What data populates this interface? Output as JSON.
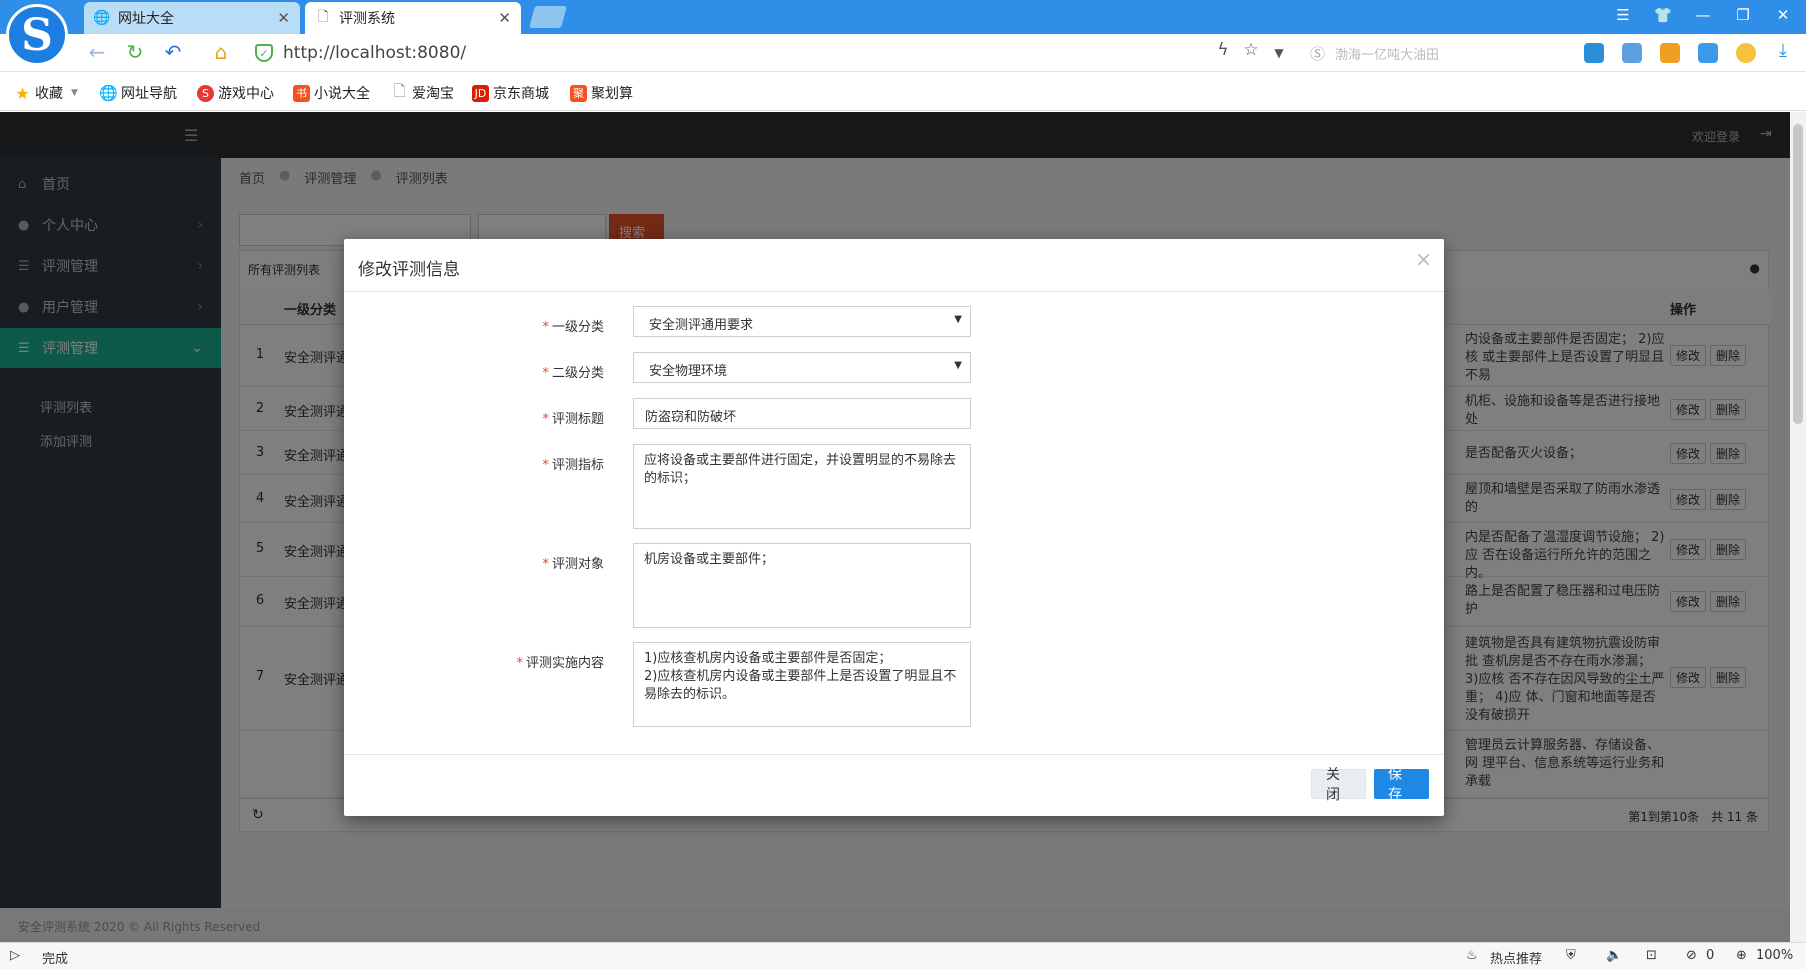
{
  "browser": {
    "tabs": [
      {
        "label": "网址大全",
        "icon": "globe-icon"
      },
      {
        "label": "评测系统",
        "icon": "page-icon"
      }
    ],
    "url": "http://localhost:8080/",
    "search_placeholder": "渤海一亿吨大油田",
    "bookmarks": [
      "收藏",
      "网址导航",
      "游戏中心",
      "小说大全",
      "爱淘宝",
      "京东商城",
      "聚划算"
    ],
    "status": {
      "left": "完成",
      "hot": "热点推荐",
      "count": "0",
      "zoom": "100%"
    }
  },
  "app": {
    "welcome": "欢迎登录",
    "sidebar": {
      "items": [
        {
          "label": "首页",
          "icon": "home-icon"
        },
        {
          "label": "个人中心",
          "icon": "user-icon"
        },
        {
          "label": "评测管理",
          "icon": "list-icon"
        },
        {
          "label": "用户管理",
          "icon": "user-icon"
        },
        {
          "label": "评测管理",
          "icon": "list-icon",
          "active": true
        }
      ],
      "subitems": [
        "评测列表",
        "添加评测"
      ]
    },
    "breadcrumb": [
      "首页",
      "评测管理",
      "评测列表"
    ],
    "list_title": "所有评测列表",
    "search_button": "搜索",
    "table": {
      "headers": [
        "一级分类",
        "操作"
      ],
      "rows": [
        {
          "no": "1",
          "cat": "安全测评通",
          "desc": "内设备或主要部件是否固定； 2)应核 或主要部件上是否设置了明显且不易"
        },
        {
          "no": "2",
          "cat": "安全测评通",
          "desc": "机柜、设施和设备等是否进行接地处"
        },
        {
          "no": "3",
          "cat": "安全测评通",
          "desc": "是否配备灭火设备；"
        },
        {
          "no": "4",
          "cat": "安全测评通",
          "desc": "屋顶和墙壁是否采取了防雨水渗透的"
        },
        {
          "no": "5",
          "cat": "安全测评通",
          "desc": "内是否配备了温湿度调节设施； 2)应 否在设备运行所允许的范围之内。"
        },
        {
          "no": "6",
          "cat": "安全测评通",
          "desc": "路上是否配置了稳压器和过电压防护"
        },
        {
          "no": "7",
          "cat": "安全测评通",
          "desc": "建筑物是否具有建筑物抗震设防审批 查机房是否不存在雨水渗漏； 3)应核 否不存在因风导致的尘土严重； 4)应 体、门窗和地面等是否没有破损开"
        },
        {
          "no": "",
          "cat": "",
          "desc": "管理员云计算服务器、存储设备、网 理平台、信息系统等运行业务和承载"
        }
      ],
      "edit_label": "修改",
      "delete_label": "删除"
    },
    "pagination": "第1到第10条　共 11 条",
    "footer": "安全评测系统 2020 © All Rights Reserved"
  },
  "modal": {
    "title": "修改评测信息",
    "fields": {
      "level1_label": "一级分类",
      "level1_value": "安全测评通用要求",
      "level2_label": "二级分类",
      "level2_value": "安全物理环境",
      "title_label": "评测标题",
      "title_value": "防盗窃和防破坏",
      "indicator_label": "评测指标",
      "indicator_value": "应将设备或主要部件进行固定，并设置明显的不易除去的标识；",
      "object_label": "评测对象",
      "object_value": "机房设备或主要部件；",
      "content_label": "评测实施内容",
      "content_value": "1)应核查机房内设备或主要部件是否固定；\n2)应核查机房内设备或主要部件上是否设置了明显且不易除去的标识。"
    },
    "close_button": "关 闭",
    "save_button": "保 存"
  },
  "colors": {
    "browser_blue": "#2f8ee8",
    "sidebar_active": "#1ab394",
    "save_button": "#1e88e5",
    "required": "#e8432f"
  }
}
